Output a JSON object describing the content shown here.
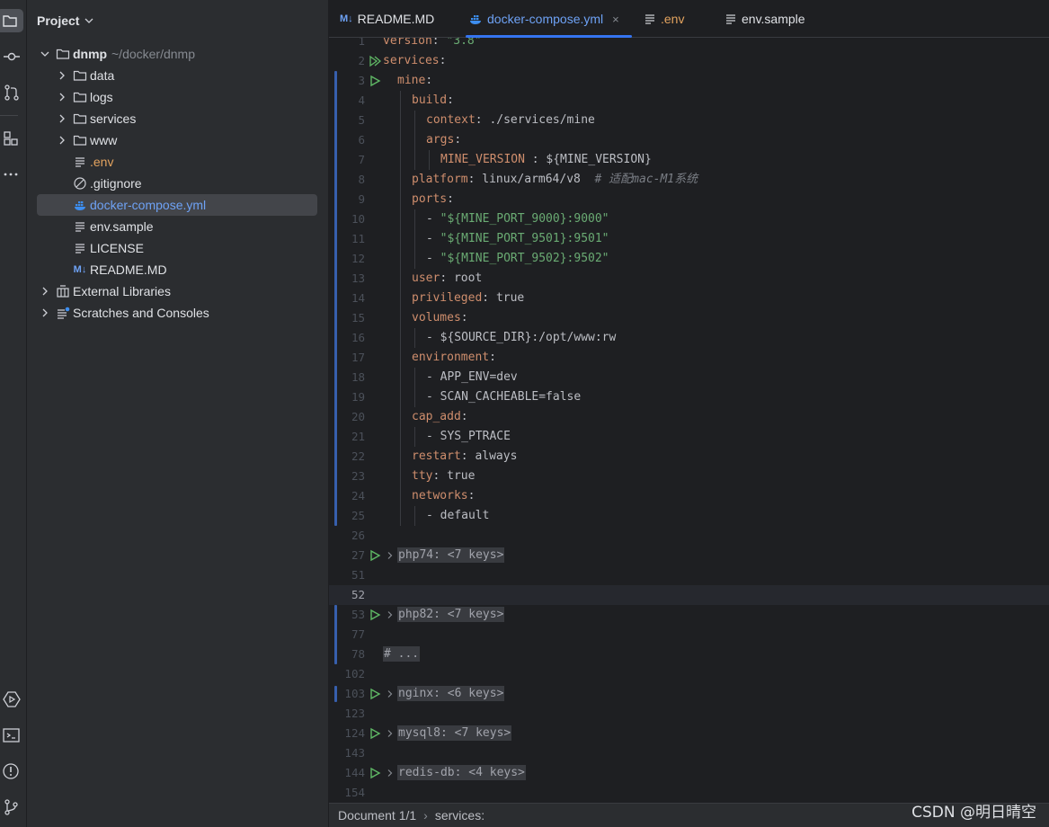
{
  "project": {
    "title": "Project",
    "root": {
      "name": "dnmp",
      "path": "~/docker/dnmp"
    },
    "folders": [
      "data",
      "logs",
      "services",
      "www"
    ],
    "files": [
      ".env",
      ".gitignore",
      "docker-compose.yml",
      "env.sample",
      "LICENSE",
      "README.MD"
    ],
    "extra": [
      "External Libraries",
      "Scratches and Consoles"
    ]
  },
  "tabs": [
    {
      "badge": "M↓",
      "label": "README.MD"
    },
    {
      "label": "docker-compose.yml",
      "close": "×"
    },
    {
      "label": ".env"
    },
    {
      "label": "env.sample"
    }
  ],
  "code": {
    "ln": [
      "1",
      "2",
      "3",
      "4",
      "5",
      "6",
      "7",
      "8",
      "9",
      "10",
      "11",
      "12",
      "13",
      "14",
      "15",
      "16",
      "17",
      "18",
      "19",
      "20",
      "21",
      "22",
      "23",
      "24",
      "25",
      "26",
      "27",
      "51",
      "52",
      "53",
      "77",
      "78",
      "102",
      "103",
      "123",
      "124",
      "143",
      "144",
      "154"
    ],
    "version_key": "version",
    "version_val": "\"3.8\"",
    "services_key": "services",
    "mine_key": "mine",
    "build_key": "build",
    "context_key": "context",
    "context_val": "./services/mine",
    "args_key": "args",
    "mine_version_key": "MINE_VERSION",
    "mine_version_val": "${MINE_VERSION}",
    "platform_key": "platform",
    "platform_val": "linux/arm64/v8",
    "platform_comment": "# 适配mac-M1系统",
    "ports_key": "ports",
    "port1": "\"${MINE_PORT_9000}:9000\"",
    "port2": "\"${MINE_PORT_9501}:9501\"",
    "port3": "\"${MINE_PORT_9502}:9502\"",
    "user_key": "user",
    "user_val": "root",
    "privileged_key": "privileged",
    "privileged_val": "true",
    "volumes_key": "volumes",
    "volume1": "${SOURCE_DIR}:/opt/www:rw",
    "environment_key": "environment",
    "env1": "APP_ENV=dev",
    "env2": "SCAN_CACHEABLE=false",
    "cap_add_key": "cap_add",
    "cap1": "SYS_PTRACE",
    "restart_key": "restart",
    "restart_val": "always",
    "tty_key": "tty",
    "tty_val": "true",
    "networks_key": "networks",
    "network1": "default",
    "fold_php74": "php74: <7 keys>",
    "fold_php82": "php82: <7 keys>",
    "fold_comment": "# ...",
    "fold_nginx": "nginx: <6 keys>",
    "fold_mysql8": "mysql8: <7 keys>",
    "fold_redis": "redis-db: <4 keys>"
  },
  "status": {
    "document": "Document 1/1",
    "breadcrumb": "services:"
  },
  "watermark": "CSDN @明日晴空"
}
